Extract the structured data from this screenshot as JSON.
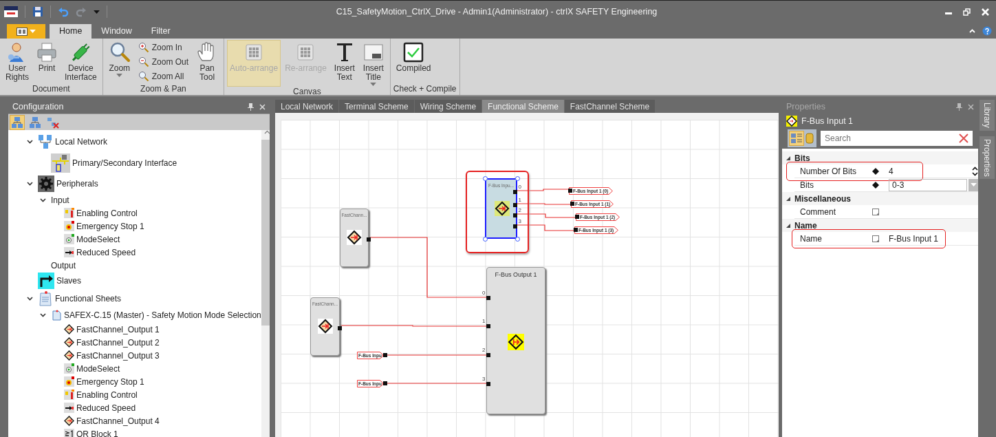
{
  "window": {
    "title": "C15_SafetyMotion_CtrlX_Drive - Admin1(Administrator) - ctrlX SAFETY Engineering"
  },
  "ribbon": {
    "tabs": [
      {
        "label": "Home",
        "selected": true
      },
      {
        "label": "Window",
        "selected": false
      },
      {
        "label": "Filter",
        "selected": false
      }
    ],
    "groups": [
      {
        "label": "Document",
        "buttons": [
          {
            "kind": "user",
            "label": "User Rights",
            "disabled": false,
            "active": false,
            "dropdown": false
          },
          {
            "kind": "print",
            "label": "Print",
            "disabled": false,
            "active": false,
            "dropdown": false
          },
          {
            "kind": "plug",
            "label": "Device Interface",
            "disabled": false,
            "active": false,
            "dropdown": false
          }
        ]
      },
      {
        "label": "Zoom & Pan",
        "buttons": [
          {
            "kind": "zoom",
            "label": "Zoom",
            "disabled": false,
            "active": false,
            "dropdown": true
          },
          {
            "kind": "zoomin",
            "label": "Zoom In",
            "disabled": false,
            "active": false,
            "dropdown": false
          },
          {
            "kind": "zoomout",
            "label": "Zoom Out",
            "disabled": false,
            "active": false,
            "dropdown": false
          },
          {
            "kind": "zoomall",
            "label": "Zoom All",
            "disabled": false,
            "active": false,
            "dropdown": false
          },
          {
            "kind": "pan",
            "label": "Pan Tool",
            "disabled": false,
            "active": false,
            "dropdown": false
          }
        ]
      },
      {
        "label": "Canvas",
        "buttons": [
          {
            "kind": "arrange",
            "label": "Auto-arrange",
            "disabled": true,
            "active": true,
            "dropdown": false
          },
          {
            "kind": "arrange",
            "label": "Re-arrange",
            "disabled": true,
            "active": false,
            "dropdown": false
          },
          {
            "kind": "text",
            "label": "Insert Text",
            "disabled": false,
            "active": false,
            "dropdown": false
          },
          {
            "kind": "title",
            "label": "Insert Title",
            "disabled": false,
            "active": false,
            "dropdown": true
          }
        ]
      },
      {
        "label": "Check + Compile",
        "buttons": [
          {
            "kind": "compiled",
            "label": "Compiled",
            "disabled": false,
            "active": false,
            "dropdown": false
          }
        ]
      }
    ]
  },
  "configuration": {
    "title": "Configuration",
    "tools": [
      {
        "kind": "network",
        "selected": true
      },
      {
        "kind": "network",
        "selected": false
      },
      {
        "kind": "remove",
        "selected": false
      }
    ],
    "tree": [
      {
        "kind": "network",
        "label": "Local Network",
        "expanded": true,
        "children": [
          {
            "kind": "interface",
            "label": "Primary/Secondary Interface"
          }
        ]
      },
      {
        "kind": "gear",
        "label": "Peripherals",
        "expanded": true,
        "children": [
          {
            "kind": "folder",
            "label": "Input",
            "expanded": true,
            "children": [
              {
                "kind": "enabling",
                "label": "Enabling Control"
              },
              {
                "kind": "estop",
                "label": "Emergency Stop 1"
              },
              {
                "kind": "mode",
                "label": "ModeSelect"
              },
              {
                "kind": "speed",
                "label": "Reduced Speed"
              }
            ]
          },
          {
            "kind": "folder",
            "label": "Output"
          }
        ]
      },
      {
        "kind": "slaves",
        "label": "Slaves"
      },
      {
        "kind": "sheets",
        "label": "Functional Sheets",
        "expanded": true,
        "children": [
          {
            "kind": "sheet",
            "label": "SAFEX-C.15 (Master) - Safety Motion Mode Selection",
            "expanded": true,
            "children": [
              {
                "kind": "fastchannel",
                "label": "FastChannel_Output 1"
              },
              {
                "kind": "fastchannel",
                "label": "FastChannel_Output 2"
              },
              {
                "kind": "fastchannel",
                "label": "FastChannel_Output 3"
              },
              {
                "kind": "mode",
                "label": "ModeSelect"
              },
              {
                "kind": "estop",
                "label": "Emergency Stop 1"
              },
              {
                "kind": "enabling",
                "label": "Enabling Control"
              },
              {
                "kind": "speed",
                "label": "Reduced Speed"
              },
              {
                "kind": "fastchannel",
                "label": "FastChannel_Output 4"
              },
              {
                "kind": "or",
                "label": "OR Block 1"
              }
            ]
          }
        ]
      }
    ]
  },
  "editor": {
    "tabs": [
      {
        "label": "Local Network",
        "selected": false
      },
      {
        "label": "Terminal Scheme",
        "selected": false
      },
      {
        "label": "Wiring Scheme",
        "selected": false
      },
      {
        "label": "Functional Scheme",
        "selected": true
      },
      {
        "label": "FastChannel Scheme",
        "selected": false
      }
    ],
    "canvas": {
      "blocks": [
        {
          "kind": "fastchannel",
          "title": "FastChann...",
          "selected": false,
          "highlighted": false
        },
        {
          "kind": "fbus_input",
          "title": "F-Bus Inpu...",
          "selected": true,
          "highlighted": true,
          "ports": [
            "0",
            "1",
            "2",
            "3"
          ]
        },
        {
          "kind": "fastchannel",
          "title": "FastChann...",
          "selected": false,
          "highlighted": false
        },
        {
          "kind": "fbus_output",
          "title": "F-Bus Output 1",
          "selected": false,
          "highlighted": false,
          "ports": [
            "0",
            "1",
            "2",
            "3"
          ]
        }
      ],
      "tags": [
        {
          "kind": "out",
          "label": "F-Bus Input 1 (0)"
        },
        {
          "kind": "out",
          "label": "F-Bus Input 1 (1)"
        },
        {
          "kind": "out",
          "label": "F-Bus Input 1 (2)"
        },
        {
          "kind": "out",
          "label": "F-Bus Input 1 (3)"
        },
        {
          "kind": "in",
          "label": "F-Bus Inpu"
        },
        {
          "kind": "in",
          "label": "F-Bus Inpu"
        }
      ]
    }
  },
  "properties": {
    "title": "Properties",
    "object": "F-Bus Input 1",
    "tools": [
      {
        "kind": "categorized",
        "selected": true
      },
      {
        "kind": "pages",
        "selected": false
      }
    ],
    "search": {
      "placeholder": "Search"
    },
    "categories": [
      {
        "label": "Bits",
        "expanded": true,
        "rows": [
          {
            "name": "Number Of Bits",
            "kind": "spin",
            "value": "4",
            "highlighted": true
          },
          {
            "name": "Bits",
            "kind": "dropdown",
            "value": "0-3",
            "highlighted": false
          }
        ]
      },
      {
        "label": "Miscellaneous",
        "expanded": true,
        "rows": [
          {
            "name": "Comment",
            "kind": "text",
            "highlighted": false
          }
        ]
      },
      {
        "label": "Name",
        "expanded": true,
        "rows": [
          {
            "name": "Name",
            "kind": "text",
            "value": "F-Bus Input 1",
            "highlighted": true
          }
        ]
      }
    ]
  },
  "side_tabs": [
    {
      "label": "Library"
    },
    {
      "label": "Properties"
    }
  ]
}
